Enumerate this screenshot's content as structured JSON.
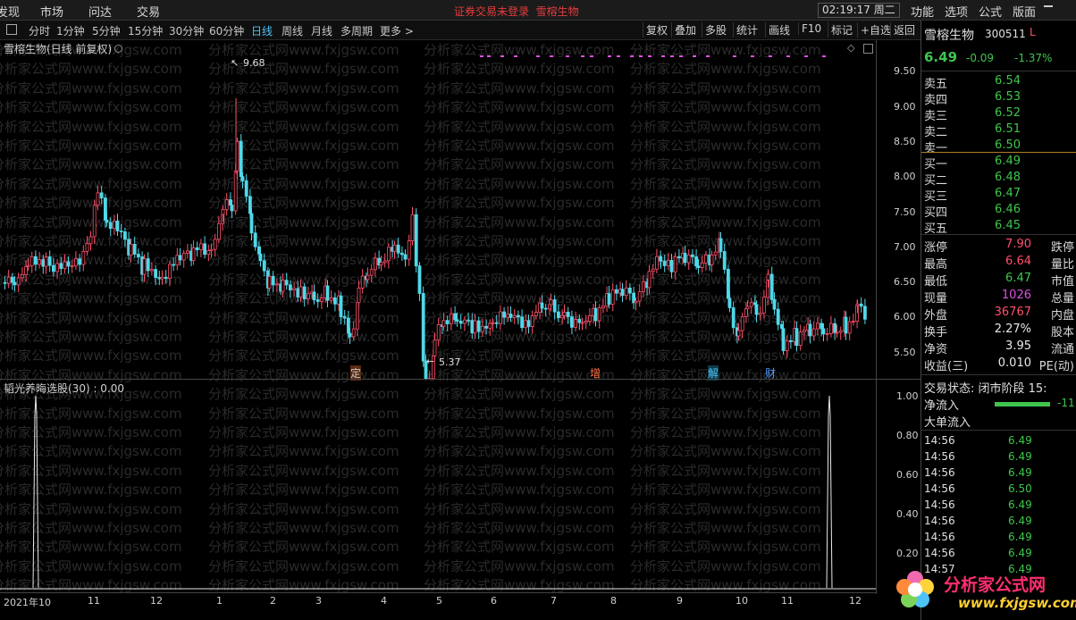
{
  "menu": {
    "items": [
      "发现",
      "市场",
      "问达",
      "交易"
    ]
  },
  "notice": {
    "text": "证券交易未登录",
    "stock": "雪榕生物"
  },
  "clock": "02:19:17 周二",
  "right_menu": [
    "功能",
    "选项",
    "公式",
    "版面"
  ],
  "periods": [
    "分时",
    "1分钟",
    "5分钟",
    "15分钟",
    "30分钟",
    "60分钟",
    "日线",
    "周线",
    "月线",
    "多周期",
    "更多 >"
  ],
  "active_period": "日线",
  "tools": [
    "复权",
    "叠加",
    "多股",
    "统计",
    "画线",
    "F10",
    "标记",
    "+自选",
    "返回"
  ],
  "chart": {
    "label": "雪榕生物(日线 前复权)",
    "high_label": "9.68",
    "low_label": "5.37"
  },
  "indicator": {
    "label": "韬光养晦选股(30) : 0.00"
  },
  "y_axis": [
    "9.50",
    "9.00",
    "8.50",
    "8.00",
    "7.50",
    "7.00",
    "6.50",
    "6.00",
    "5.50"
  ],
  "y_axis_ind": [
    "1.00",
    "0.80",
    "0.60",
    "0.40",
    "0.20"
  ],
  "x_axis": [
    "2021年10",
    "11",
    "12",
    "1",
    "2",
    "3",
    "4",
    "5",
    "6",
    "7",
    "8",
    "9",
    "10",
    "11",
    "12"
  ],
  "markers": [
    {
      "text": "定",
      "color": "#ff7043"
    },
    {
      "text": "增",
      "color": "#ff7043"
    },
    {
      "text": "解",
      "color": "#4fc3f7"
    },
    {
      "text": "财",
      "color": "#4f9bff"
    }
  ],
  "quote": {
    "name": "雪榕生物",
    "code": "300511",
    "flag": "L",
    "price": "6.49",
    "change": "-0.09",
    "pct": "-1.37%",
    "asks": [
      {
        "label": "卖五",
        "price": "6.54"
      },
      {
        "label": "卖四",
        "price": "6.53"
      },
      {
        "label": "卖三",
        "price": "6.52"
      },
      {
        "label": "卖二",
        "price": "6.51"
      },
      {
        "label": "卖一",
        "price": "6.50"
      }
    ],
    "bids": [
      {
        "label": "买一",
        "price": "6.49"
      },
      {
        "label": "买二",
        "price": "6.48"
      },
      {
        "label": "买三",
        "price": "6.47"
      },
      {
        "label": "买四",
        "price": "6.46"
      },
      {
        "label": "买五",
        "price": "6.45"
      }
    ],
    "stats": [
      {
        "k": "涨停",
        "v": "7.90",
        "c": "red",
        "k2": "跌停"
      },
      {
        "k": "最高",
        "v": "6.64",
        "c": "red",
        "k2": "量比"
      },
      {
        "k": "最低",
        "v": "6.47",
        "c": "",
        "k2": "市值"
      },
      {
        "k": "现量",
        "v": "1026",
        "c": "mag",
        "k2": "总量"
      },
      {
        "k": "外盘",
        "v": "36767",
        "c": "red",
        "k2": "内盘"
      },
      {
        "k": "换手",
        "v": "2.27%",
        "c": "wht",
        "k2": "股本"
      },
      {
        "k": "净资",
        "v": "3.95",
        "c": "wht",
        "k2": "流通"
      },
      {
        "k": "收益(三)",
        "v": "0.010",
        "c": "wht",
        "k2": "PE(动)"
      }
    ],
    "trade_state": "交易状态: 闭市阶段 15:",
    "net_inflow_label": "净流入",
    "net_inflow": "-11",
    "big_inflow_label": "大单流入",
    "ticks": [
      {
        "t": "14:56",
        "p": "6.49"
      },
      {
        "t": "14:56",
        "p": "6.49"
      },
      {
        "t": "14:56",
        "p": "6.49"
      },
      {
        "t": "14:56",
        "p": "6.50"
      },
      {
        "t": "14:56",
        "p": "6.49"
      },
      {
        "t": "14:56",
        "p": "6.49"
      },
      {
        "t": "14:56",
        "p": "6.49"
      },
      {
        "t": "14:56",
        "p": "6.49"
      },
      {
        "t": "14:57",
        "p": "6.49"
      }
    ]
  },
  "watermark": "分析家公式网www.fxjgsw.com",
  "logo": {
    "title": "分析家公式网",
    "url": "www.fxjgsw.com"
  }
}
